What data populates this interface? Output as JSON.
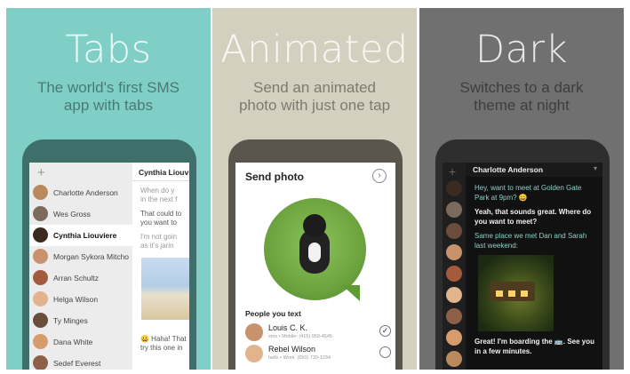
{
  "panels": [
    {
      "headline": "Tabs",
      "subtitle_lines": [
        "The world's first SMS",
        "app with tabs"
      ],
      "add_button": "+",
      "conversations": [
        "Charlotte Anderson",
        "Wes Gross",
        "Cynthia Liouviere",
        "Morgan Sykora Mitcho",
        "Arran Schultz",
        "Helga Wilson",
        "Ty Minges",
        "Dana White",
        "Sedef Everest"
      ],
      "active_index": 2,
      "thread_title": "Cynthia Liouvi",
      "messages": [
        {
          "text": "When do y",
          "style": "light"
        },
        {
          "text": "in the next f",
          "style": "light"
        },
        {
          "text": "That could to",
          "style": "dark"
        },
        {
          "text": "you want to",
          "style": "dark"
        },
        {
          "text": "I'm not goin",
          "style": "light"
        },
        {
          "text": "as it's jarin",
          "style": "light"
        },
        {
          "text": "😀 Haha! That",
          "style": "dark"
        },
        {
          "text": "try this one in",
          "style": "dark"
        }
      ]
    },
    {
      "headline": "Animated",
      "subtitle_lines": [
        "Send an animated",
        "photo with just one tap"
      ],
      "screen_title": "Send photo",
      "next_icon": "›",
      "section_label": "People you text",
      "contacts": [
        {
          "name": "Louis C. K.",
          "detail": "sms • Mobile: (415) 959-4545",
          "check": "✓"
        },
        {
          "name": "Rebel Wilson",
          "detail": "hello • Work: (650) 739-1234",
          "check": ""
        }
      ]
    },
    {
      "headline": "Dark",
      "subtitle_lines": [
        "Switches to a dark",
        "theme at night"
      ],
      "add_button": "+",
      "thread_title": "Charlotte Anderson",
      "caret": "▾",
      "messages": [
        {
          "text": "Hey, want to meet at Golden Gate",
          "style": "in"
        },
        {
          "text": "Park at 9pm? 😀",
          "style": "in"
        },
        {
          "text": "Yeah, that sounds great. Where do",
          "style": "out"
        },
        {
          "text": "you want to meet?",
          "style": "out"
        },
        {
          "text": "Same place we met Dan and Sarah",
          "style": "in"
        },
        {
          "text": "last weekend:",
          "style": "in"
        },
        {
          "text": "Great! I'm boarding the 🚌. See you",
          "style": "out"
        },
        {
          "text": "in a few minutes.",
          "style": "out"
        }
      ]
    }
  ],
  "colors": {
    "tabs_bg": "#7fcfc6",
    "animated_bg": "#d5cfbf",
    "dark_bg": "#707070",
    "incoming_dark_text": "#8fd0c8"
  }
}
